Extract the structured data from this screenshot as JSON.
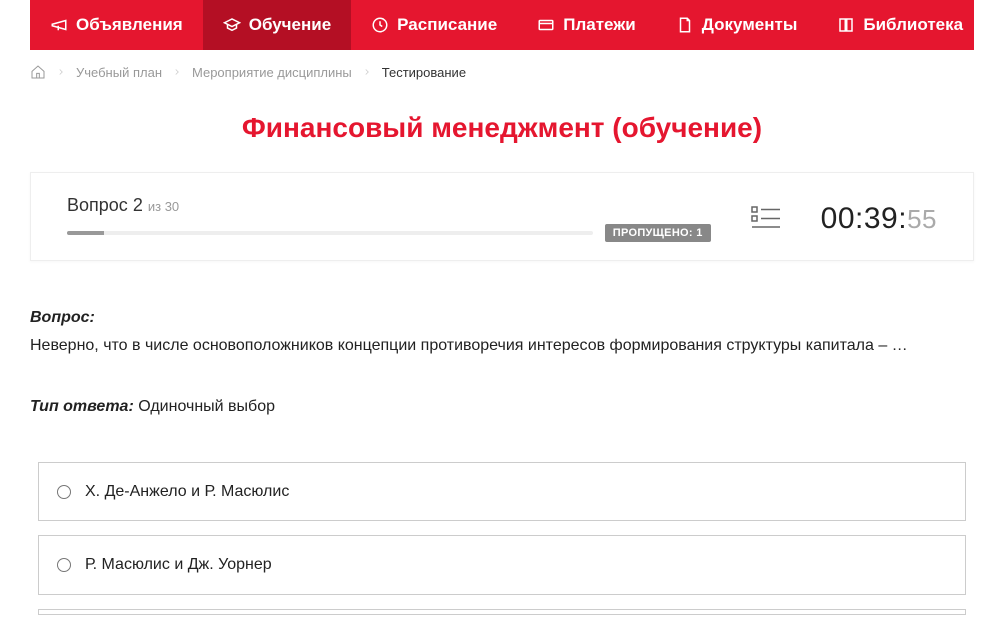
{
  "nav": {
    "items": [
      {
        "label": "Объявления",
        "icon": "megaphone-icon",
        "active": false
      },
      {
        "label": "Обучение",
        "icon": "education-icon",
        "active": true
      },
      {
        "label": "Расписание",
        "icon": "clock-icon",
        "active": false
      },
      {
        "label": "Платежи",
        "icon": "payment-icon",
        "active": false
      },
      {
        "label": "Документы",
        "icon": "document-icon",
        "active": false
      },
      {
        "label": "Библиотека",
        "icon": "book-icon",
        "active": false,
        "dropdown": true
      }
    ]
  },
  "breadcrumb": {
    "items": [
      {
        "label": "Учебный план"
      },
      {
        "label": "Мероприятие дисциплины"
      }
    ],
    "current": "Тестирование"
  },
  "page": {
    "title": "Финансовый менеджмент (обучение)"
  },
  "quiz": {
    "question_label": "Вопрос",
    "question_number": "2",
    "of_label": "из",
    "total": "30",
    "skipped_label": "ПРОПУЩЕНО: 1",
    "timer_main": "00:39:",
    "timer_sec": "55"
  },
  "question": {
    "label": "Вопрос:",
    "text": "Неверно, что в числе основоположников концепции противоречия интересов формирования структуры капитала – …",
    "answer_type_label": "Тип ответа:",
    "answer_type": "Одиночный выбор",
    "options": [
      "Х. Де-Анжело и Р. Масюлис",
      "Р. Масюлис и Дж. Уорнер"
    ]
  }
}
